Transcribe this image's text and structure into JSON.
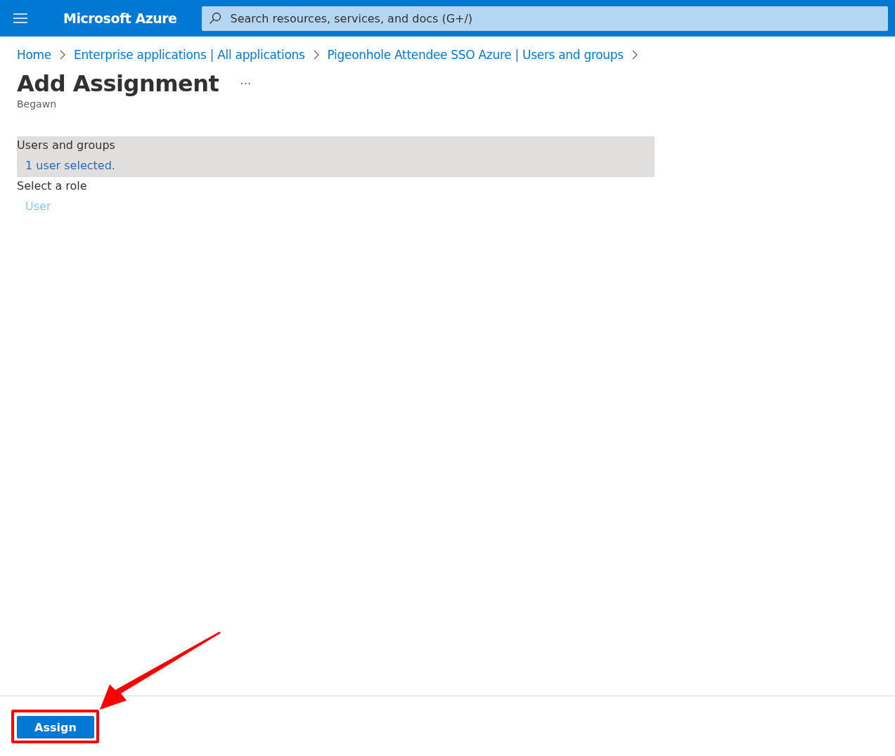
{
  "header": {
    "title": "Microsoft Azure",
    "search": {
      "placeholder": "Search resources, services, and docs (G+/)"
    }
  },
  "breadcrumb": [
    "Home",
    "Enterprise applications | All applications",
    "Pigeonhole Attendee SSO Azure | Users and groups"
  ],
  "page": {
    "title": "Add Assignment",
    "more": "···",
    "subtitle": "Begawn"
  },
  "sections": [
    {
      "label": "Users and groups",
      "value": "1 user selected.",
      "selected": true,
      "disabled": false
    },
    {
      "label": "Select a role",
      "value": "User",
      "selected": false,
      "disabled": true
    }
  ],
  "footer": {
    "button": "Assign",
    "highlighted": true
  }
}
